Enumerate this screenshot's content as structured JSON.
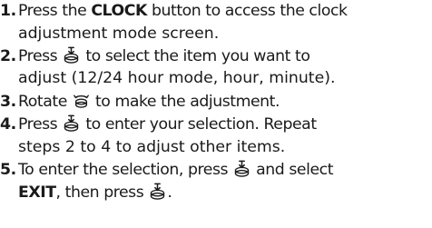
{
  "steps": [
    {
      "number": "1.",
      "t1": "Press the ",
      "b1": "CLOCK",
      "t2": " button to access the clock",
      "t3": "adjustment mode screen."
    },
    {
      "number": "2.",
      "t1": "Press ",
      "icon1": "push-selector-icon",
      "t2": " to select the item you want to",
      "t3": "adjust (12/24 hour mode, hour, minute)."
    },
    {
      "number": "3.",
      "t1": "Rotate ",
      "icon1": "rotate-selector-icon",
      "t2": " to make the adjustment."
    },
    {
      "number": "4.",
      "t1": "Press ",
      "icon1": "push-selector-icon",
      "t2": " to enter your selection. Repeat",
      "t3": "steps 2 to 4 to adjust other items."
    },
    {
      "number": "5.",
      "t1": "To enter the selection, press ",
      "icon1": "push-selector-icon",
      "t2": " and select",
      "b1": "EXIT",
      "t3": ", then press ",
      "icon2": "push-selector-icon",
      "t4": "."
    }
  ]
}
